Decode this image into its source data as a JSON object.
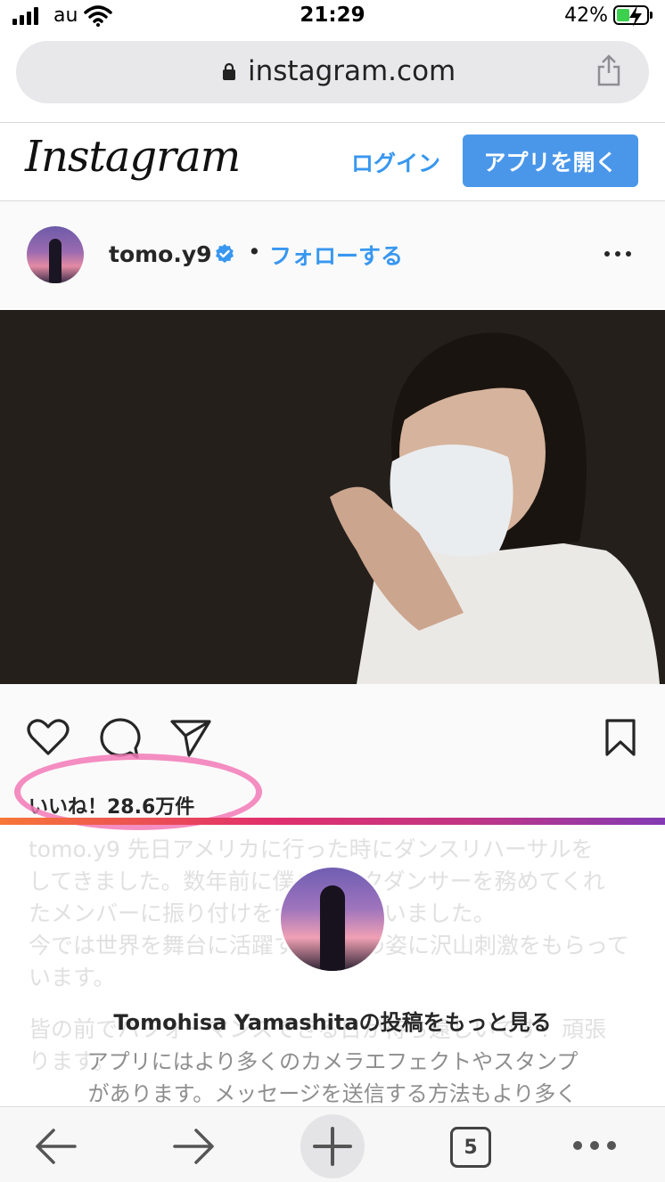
{
  "status_bar": {
    "carrier": "au",
    "time": "21:29",
    "battery": "42%"
  },
  "browser": {
    "url": "instagram.com"
  },
  "header": {
    "logo": "Instagram",
    "login": "ログイン",
    "open_app": "アプリを開く"
  },
  "post": {
    "username": "tomo.y9",
    "separator": "•",
    "follow": "フォローする",
    "likes": "いいね！28.6万件",
    "caption_lines": [
      "tomo.y9 先日アメリカに行った時にダンスリハーサルを",
      "してきました。数年前に僕のバックダンサーを務めてくれ",
      "たメンバーに振り付けをつけてもらいました。",
      "今では世界を舞台に活躍する彼らの姿に沢山刺激をもらって",
      "います。",
      "",
      "皆の前でパフォーマンスできる日が待ち遠しいです！頑張",
      "ります。"
    ]
  },
  "overlay": {
    "title": "Tomohisa Yamashitaの投稿をもっと見る",
    "desc_line1": "アプリにはより多くのカメラエフェクトやスタンプ",
    "desc_line2": "があります。メッセージを送信する方法もより多く"
  },
  "toolbar": {
    "tab_count": "5"
  },
  "colors": {
    "accent": "#3897f0",
    "button": "#4a97ea",
    "highlight": "#f279b6"
  }
}
